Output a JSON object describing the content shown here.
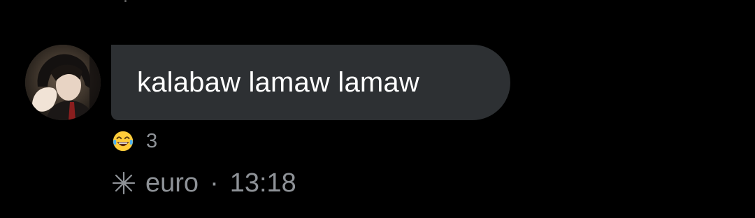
{
  "message": {
    "text": "kalabaw lamaw lamaw",
    "bubble_color": "#2d3033"
  },
  "reaction": {
    "emoji_icon": "face-with-tears-of-joy-icon",
    "count": "3"
  },
  "meta": {
    "icon": "sparkle-icon",
    "author": "euro",
    "separator": "·",
    "time": "13:18"
  },
  "colors": {
    "background": "#000000",
    "muted_text": "#8e9297",
    "message_text": "#ffffff"
  }
}
